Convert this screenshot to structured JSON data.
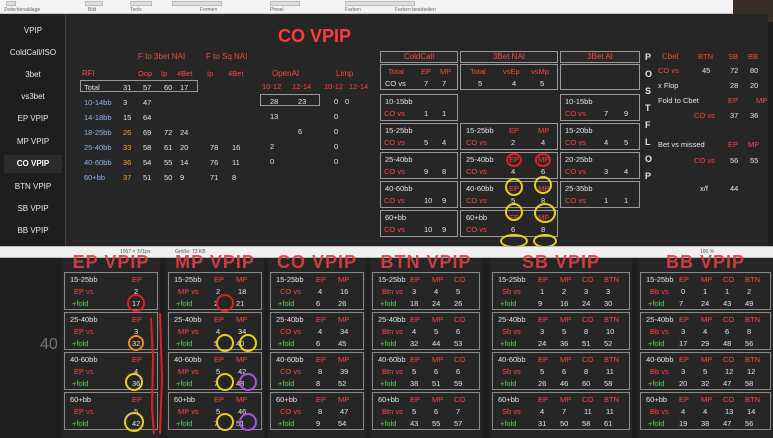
{
  "app": {
    "title": "CO VPIP"
  },
  "sidebar": {
    "items": [
      "VPIP",
      "ColdCall/ISO",
      "3bet",
      "vs3bet",
      "EP VPIP",
      "MP VPIP",
      "CO VPIP",
      "BTN VPIP",
      "SB VPIP",
      "BB VPIP"
    ],
    "active": "CO VPIP"
  },
  "rfi": {
    "title": "RFI",
    "group1": "F to 3bet NAI",
    "group2": "F to Sq NAI",
    "cols": [
      "Oop",
      "Ip",
      "4Bet",
      "Ip",
      "4Bet"
    ],
    "rows": [
      [
        "Total",
        "31",
        "57",
        "60",
        "17",
        "",
        ""
      ],
      [
        "10-14bb",
        "3",
        "47",
        "",
        "",
        "",
        ""
      ],
      [
        "14-18bb",
        "15",
        "64",
        "",
        "",
        "",
        ""
      ],
      [
        "18-25bb",
        "26",
        "69",
        "72",
        "24",
        "",
        ""
      ],
      [
        "25-40bb",
        "33",
        "58",
        "61",
        "20",
        "78",
        "16"
      ],
      [
        "40-60bb",
        "36",
        "54",
        "55",
        "14",
        "76",
        "11"
      ],
      [
        "60+bb",
        "37",
        "51",
        "50",
        "9",
        "71",
        "8"
      ]
    ]
  },
  "openai": {
    "title": "OpenAI",
    "cols": [
      "10-12",
      "12-14"
    ],
    "rows": [
      [
        "28",
        "23"
      ],
      [
        "13",
        ""
      ],
      [
        "",
        "6"
      ],
      [
        "2",
        ""
      ],
      [
        "0",
        ""
      ]
    ]
  },
  "limp": {
    "title": "Limp",
    "cols": [
      "10-12",
      "12-14"
    ],
    "rows": [
      [
        "0",
        "0"
      ],
      [
        "0",
        ""
      ],
      [
        "0",
        ""
      ],
      [
        "0",
        ""
      ],
      [
        "0",
        ""
      ]
    ]
  },
  "coldcall": {
    "title": "ColdCall",
    "total": [
      "Total",
      "EP",
      "MP"
    ],
    "totalvals": [
      "CO vs",
      "7",
      "7"
    ],
    "rows": [
      {
        "label": "10-15bb",
        "vals": [
          "1",
          "1"
        ]
      },
      {
        "label": "15-25bb",
        "vals": [
          "5",
          "4"
        ]
      },
      {
        "label": "25-40bb",
        "vals": [
          "9",
          "8"
        ]
      },
      {
        "label": "40-60bb",
        "vals": [
          "10",
          "9"
        ]
      },
      {
        "label": "60+bb",
        "vals": [
          "10",
          "9"
        ]
      }
    ]
  },
  "bet3nai": {
    "title": "3Bet NAI",
    "total": [
      "Total",
      "vsEp",
      "vsMp"
    ],
    "totalvals": [
      "5",
      "4",
      "5"
    ],
    "rows": [
      {
        "label": "15-25bb",
        "vals": [
          "2",
          "4"
        ]
      },
      {
        "label": "25-40bb",
        "vals": [
          "4",
          "6"
        ]
      },
      {
        "label": "40-60bb",
        "vals": [
          "5",
          "8"
        ]
      },
      {
        "label": "60+bb",
        "vals": [
          "6",
          "8"
        ]
      }
    ]
  },
  "bet3ai": {
    "title": "3Bet AI",
    "rows": [
      {
        "label": "10-15bb",
        "vals": [
          "7",
          "9"
        ]
      },
      {
        "label": "15-20bb",
        "vals": [
          "4",
          "5"
        ]
      },
      {
        "label": "20-25bb",
        "vals": [
          "3",
          "4"
        ]
      },
      {
        "label": "25-35bb",
        "vals": [
          "1",
          "1"
        ]
      }
    ]
  },
  "postflop": {
    "letters": [
      "P",
      "O",
      "S",
      "T",
      "F",
      "L",
      "O",
      "P"
    ],
    "cbet": {
      "label": "Cbet",
      "cols": [
        "BTN",
        "SB",
        "BB"
      ],
      "rows": [
        [
          "CO vs",
          "45",
          "72",
          "80"
        ],
        [
          "x Flop",
          "",
          "28",
          "20"
        ],
        [
          "Fold to Cbet",
          "EP",
          "MP",
          ""
        ],
        [
          "CO vs",
          "",
          "37",
          "36"
        ]
      ]
    },
    "bvm": {
      "label": "Bet vs missed",
      "cols": [
        "EP",
        "MP"
      ],
      "rows": [
        [
          "CO vs",
          "56",
          "55"
        ]
      ]
    },
    "xf": [
      "x/f",
      "44"
    ]
  },
  "statusbar": {
    "items": [
      "1057 × 371px",
      "Größe: 73 KB",
      "100 %"
    ]
  },
  "ribbon": {
    "labels": [
      "Zwischenablage",
      "Bild",
      "Tools",
      "Pinsel",
      "Formen",
      "Farben",
      "Größe",
      "Farbe 1",
      "Farbe 2",
      "Farben bearbeiten"
    ]
  },
  "lower": {
    "panels": [
      {
        "title": "EP VPIP",
        "prefix": "EP vs",
        "cols": [
          "EP"
        ],
        "groups": [
          [
            "15-25bb",
            "2",
            "17"
          ],
          [
            "25-40bb",
            "3",
            "32"
          ],
          [
            "40-60bb",
            "4",
            "36"
          ],
          [
            "60+bb",
            "5",
            "42"
          ]
        ]
      },
      {
        "title": "MP VPIP",
        "prefix": "MP vs",
        "cols": [
          "EP",
          "MP"
        ],
        "groups": [
          [
            "15-25bb",
            "2",
            "18",
            "2",
            "21"
          ],
          [
            "25-40bb",
            "4",
            "34",
            "5",
            "40"
          ],
          [
            "40-60bb",
            "5",
            "42",
            "7",
            "48"
          ],
          [
            "60+bb",
            "5",
            "46",
            "7",
            "51"
          ]
        ]
      },
      {
        "title": "CO VPIP",
        "prefix": "CO vs",
        "cols": [
          "EP",
          "MP"
        ],
        "groups": [
          [
            "15-25bb",
            "4",
            "16",
            "6",
            "26"
          ],
          [
            "25-40bb",
            "4",
            "34",
            "6",
            "45"
          ],
          [
            "40-60bb",
            "8",
            "39",
            "8",
            "52"
          ],
          [
            "60+bb",
            "8",
            "47",
            "9",
            "54"
          ]
        ]
      },
      {
        "title": "BTN VPIP",
        "prefix": "Btn vs",
        "cols": [
          "EP",
          "MP",
          "CO"
        ],
        "groups": [
          [
            "15-25bb",
            "3",
            "4",
            "5",
            "18",
            "24",
            "26"
          ],
          [
            "25-40bb",
            "4",
            "5",
            "6",
            "32",
            "44",
            "53"
          ],
          [
            "40-60bb",
            "5",
            "6",
            "6",
            "38",
            "51",
            "59"
          ],
          [
            "60+bb",
            "5",
            "6",
            "7",
            "43",
            "55",
            "57"
          ]
        ]
      },
      {
        "title": "SB VPIP",
        "prefix": "Sb vs",
        "cols": [
          "EP",
          "MP",
          "CO",
          "BTN"
        ],
        "groups": [
          [
            "15-25bb",
            "1",
            "2",
            "3",
            "3",
            "9",
            "16",
            "24",
            "30"
          ],
          [
            "25-40bb",
            "3",
            "5",
            "8",
            "10",
            "24",
            "36",
            "51",
            "52"
          ],
          [
            "40-60bb",
            "5",
            "6",
            "8",
            "11",
            "26",
            "46",
            "60",
            "58"
          ],
          [
            "60+bb",
            "4",
            "7",
            "11",
            "11",
            "31",
            "50",
            "58",
            "61"
          ]
        ]
      },
      {
        "title": "BB VPIP",
        "prefix": "Bb vs",
        "cols": [
          "EP",
          "MP",
          "CO",
          "BTN"
        ],
        "groups": [
          [
            "15-25bb",
            "0",
            "1",
            "1",
            "2",
            "7",
            "24",
            "43",
            "49"
          ],
          [
            "25-40bb",
            "3",
            "4",
            "6",
            "8",
            "17",
            "29",
            "48",
            "56"
          ],
          [
            "40-60bb",
            "3",
            "5",
            "12",
            "12",
            "20",
            "32",
            "47",
            "58"
          ],
          [
            "60+bb",
            "4",
            "4",
            "13",
            "14",
            "19",
            "38",
            "47",
            "56"
          ]
        ]
      }
    ],
    "foldlabel": "+fold",
    "margin_note": "40"
  }
}
